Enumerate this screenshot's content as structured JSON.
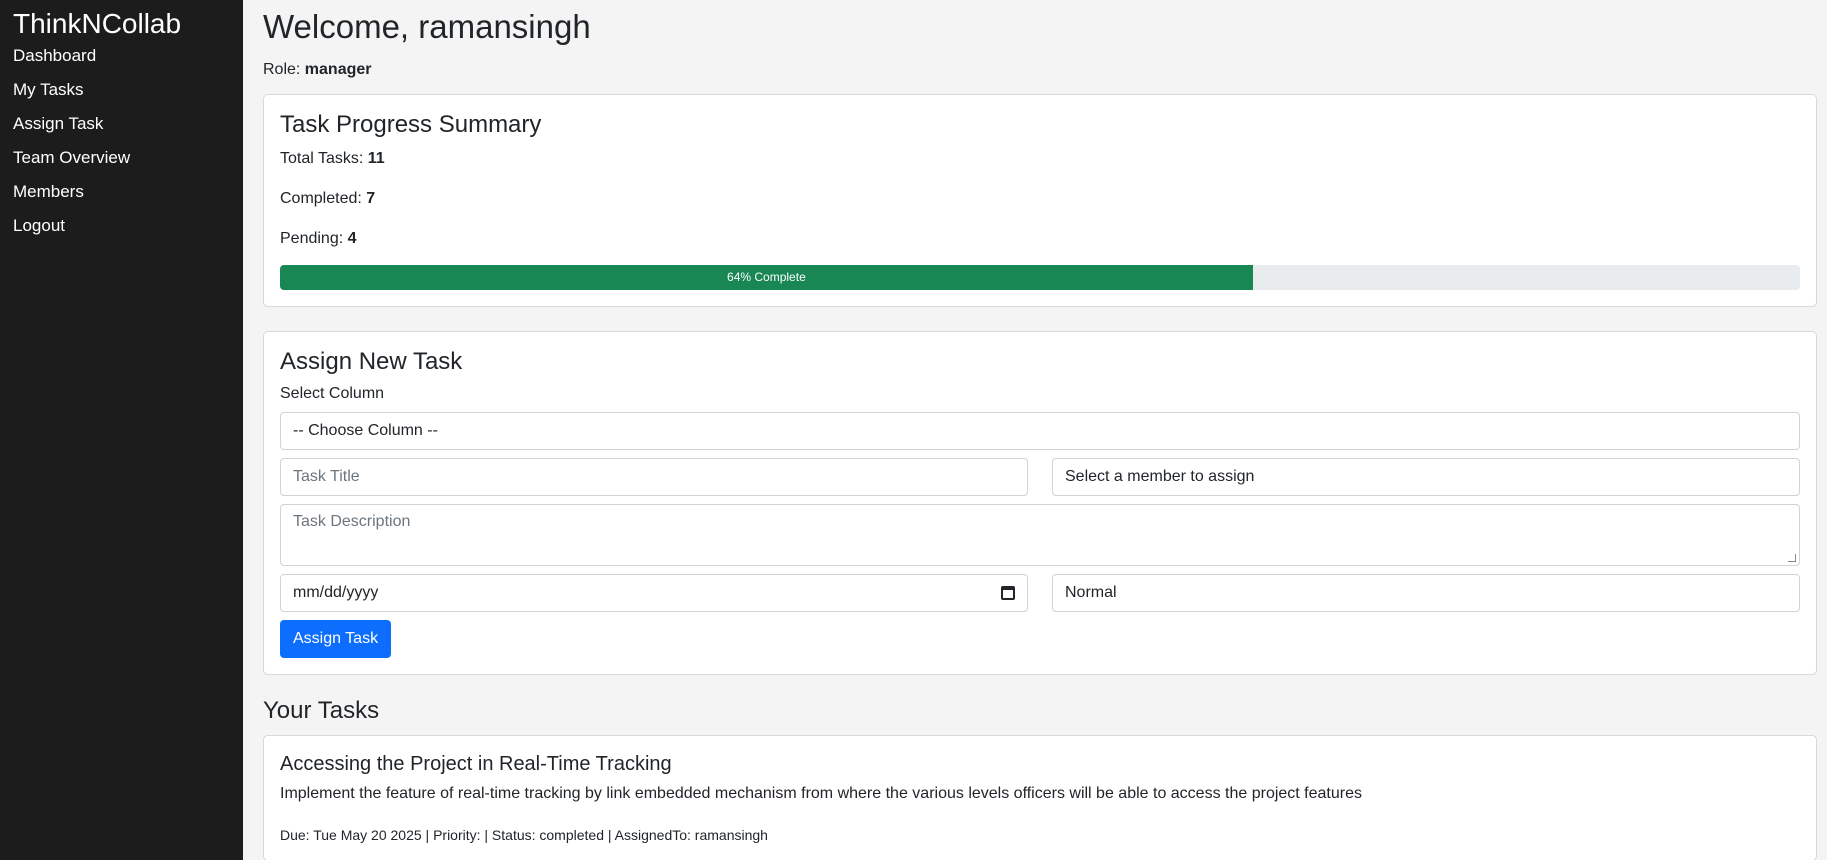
{
  "sidebar": {
    "brand": "ThinkNCollab",
    "items": [
      {
        "label": "Dashboard"
      },
      {
        "label": "My Tasks"
      },
      {
        "label": "Assign Task"
      },
      {
        "label": "Team Overview"
      },
      {
        "label": "Members"
      },
      {
        "label": "Logout"
      }
    ]
  },
  "header": {
    "welcome": "Welcome, ramansingh",
    "role_label": "Role: ",
    "role_value": "manager"
  },
  "summary": {
    "title": "Task Progress Summary",
    "total_label": "Total Tasks: ",
    "total_value": "11",
    "completed_label": "Completed: ",
    "completed_value": "7",
    "pending_label": "Pending: ",
    "pending_value": "4",
    "progress_percent": 64,
    "progress_text": "64% Complete",
    "progress_color": "#198754"
  },
  "assign": {
    "title": "Assign New Task",
    "column_label": "Select Column",
    "column_select_value": "-- Choose Column --",
    "task_title_placeholder": "Task Title",
    "member_select_value": "Select a member to assign",
    "description_placeholder": "Task Description",
    "date_placeholder": "mm/dd/yyyy",
    "priority_select_value": "Normal",
    "submit_label": "Assign Task",
    "button_color": "#0d6efd"
  },
  "tasks": {
    "title": "Your Tasks",
    "items": [
      {
        "title": "Accessing the Project in Real-Time Tracking",
        "description": "Implement the feature of real-time tracking by link embedded mechanism from where the various levels officers will be able to access the project features",
        "meta": "Due: Tue May 20 2025 | Priority: | Status: completed | AssignedTo: ramansingh"
      }
    ]
  }
}
